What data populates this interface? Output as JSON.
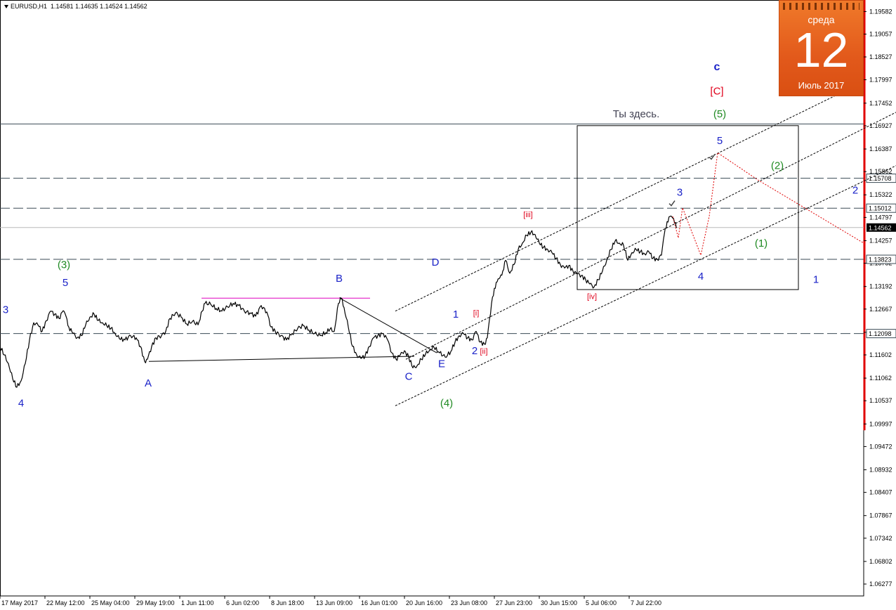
{
  "header": {
    "symbol": "EURUSD,H1",
    "ohlc": "1.14581 1.14635 1.14524 1.14562"
  },
  "calendar": {
    "weekday": "среда",
    "day": "12",
    "month_year": "Июль 2017"
  },
  "colors": {
    "wave_blue": "#1a22c8",
    "wave_green": "#1f8a22",
    "wave_red": "#e0001a",
    "price": "#000000",
    "magenta": "#e000c0",
    "calendar_orange": "#e65c17",
    "scale_bar": "#e00000",
    "forecast": "#e00000"
  },
  "chart_data": {
    "type": "line",
    "title": "",
    "xlabel": "",
    "ylabel": "",
    "ylim": [
      1.06,
      1.1985
    ],
    "y_ticks": [
      "1.19582",
      "1.19057",
      "1.18527",
      "1.17997",
      "1.17452",
      "1.16927",
      "1.16387",
      "1.15862",
      "1.15322",
      "1.14797",
      "1.14257",
      "1.13732",
      "1.13192",
      "1.12667",
      "1.12127",
      "1.11602",
      "1.11062",
      "1.10537",
      "1.09997",
      "1.09472",
      "1.08932",
      "1.08407",
      "1.07867",
      "1.07342",
      "1.06802",
      "1.06277"
    ],
    "x_ticks": [
      {
        "label": "17 May 2017",
        "t": 0
      },
      {
        "label": "22 May 12:00",
        "t": 64
      },
      {
        "label": "25 May 04:00",
        "t": 128
      },
      {
        "label": "29 May 19:00",
        "t": 192
      },
      {
        "label": "1 Jun 11:00",
        "t": 256
      },
      {
        "label": "6 Jun 02:00",
        "t": 320
      },
      {
        "label": "8 Jun 18:00",
        "t": 384
      },
      {
        "label": "13 Jun 09:00",
        "t": 448
      },
      {
        "label": "16 Jun 01:00",
        "t": 512
      },
      {
        "label": "20 Jun 16:00",
        "t": 576
      },
      {
        "label": "23 Jun 08:00",
        "t": 640
      },
      {
        "label": "27 Jun 23:00",
        "t": 704
      },
      {
        "label": "30 Jun 15:00",
        "t": 768
      },
      {
        "label": "5 Jul 06:00",
        "t": 832
      },
      {
        "label": "7 Jul 22:00",
        "t": 896
      }
    ],
    "current_price": "1.14562",
    "levels": [
      {
        "value": 1.15708,
        "label": "1.15708",
        "style": "dash"
      },
      {
        "value": 1.15012,
        "label": "1.15012",
        "style": "dash"
      },
      {
        "value": 1.13823,
        "label": "1.13823",
        "style": "dash"
      },
      {
        "value": 1.12098,
        "label": "1.12098",
        "style": "dash"
      },
      {
        "value": 1.14562,
        "label": "1.14562",
        "style": "current"
      },
      {
        "value": 1.1697,
        "label": "",
        "style": "solid"
      }
    ],
    "series": [
      {
        "name": "",
        "points": [
          [
            0,
            1.118
          ],
          [
            6,
            1.116
          ],
          [
            12,
            1.114
          ],
          [
            18,
            1.1105
          ],
          [
            24,
            1.1085
          ],
          [
            30,
            1.11
          ],
          [
            36,
            1.114
          ],
          [
            42,
            1.1195
          ],
          [
            48,
            1.1235
          ],
          [
            54,
            1.123
          ],
          [
            60,
            1.1215
          ],
          [
            66,
            1.124
          ],
          [
            72,
            1.1262
          ],
          [
            78,
            1.1255
          ],
          [
            84,
            1.1245
          ],
          [
            90,
            1.1263
          ],
          [
            94,
            1.125
          ],
          [
            98,
            1.1225
          ],
          [
            104,
            1.121
          ],
          [
            110,
            1.12
          ],
          [
            116,
            1.1205
          ],
          [
            122,
            1.123
          ],
          [
            128,
            1.1248
          ],
          [
            134,
            1.1255
          ],
          [
            140,
            1.124
          ],
          [
            146,
            1.1235
          ],
          [
            152,
            1.1228
          ],
          [
            158,
            1.1222
          ],
          [
            164,
            1.121
          ],
          [
            170,
            1.1198
          ],
          [
            178,
            1.1195
          ],
          [
            186,
            1.1205
          ],
          [
            194,
            1.12
          ],
          [
            200,
            1.118
          ],
          [
            206,
            1.1145
          ],
          [
            210,
            1.115
          ],
          [
            216,
            1.118
          ],
          [
            222,
            1.12
          ],
          [
            230,
            1.1205
          ],
          [
            236,
            1.1215
          ],
          [
            242,
            1.1245
          ],
          [
            250,
            1.1258
          ],
          [
            258,
            1.1248
          ],
          [
            266,
            1.1232
          ],
          [
            274,
            1.1238
          ],
          [
            282,
            1.123
          ],
          [
            288,
            1.1262
          ],
          [
            292,
            1.128
          ],
          [
            300,
            1.1278
          ],
          [
            308,
            1.1268
          ],
          [
            316,
            1.1262
          ],
          [
            324,
            1.1272
          ],
          [
            332,
            1.128
          ],
          [
            340,
            1.1275
          ],
          [
            348,
            1.1262
          ],
          [
            356,
            1.1258
          ],
          [
            364,
            1.125
          ],
          [
            372,
            1.1275
          ],
          [
            380,
            1.126
          ],
          [
            386,
            1.1225
          ],
          [
            392,
            1.1215
          ],
          [
            400,
            1.1205
          ],
          [
            408,
            1.1195
          ],
          [
            416,
            1.121
          ],
          [
            424,
            1.1222
          ],
          [
            432,
            1.1228
          ],
          [
            440,
            1.1218
          ],
          [
            448,
            1.121
          ],
          [
            456,
            1.1205
          ],
          [
            464,
            1.1212
          ],
          [
            470,
            1.122
          ],
          [
            476,
            1.1215
          ],
          [
            482,
            1.128
          ],
          [
            486,
            1.1292
          ],
          [
            490,
            1.127
          ],
          [
            496,
            1.1225
          ],
          [
            502,
            1.118
          ],
          [
            508,
            1.116
          ],
          [
            514,
            1.1152
          ],
          [
            520,
            1.1158
          ],
          [
            526,
            1.118
          ],
          [
            532,
            1.12
          ],
          [
            538,
            1.1205
          ],
          [
            546,
            1.121
          ],
          [
            552,
            1.1195
          ],
          [
            558,
            1.1165
          ],
          [
            564,
            1.115
          ],
          [
            570,
            1.116
          ],
          [
            576,
            1.117
          ],
          [
            582,
            1.1155
          ],
          [
            588,
            1.113
          ],
          [
            594,
            1.1135
          ],
          [
            600,
            1.115
          ],
          [
            606,
            1.1162
          ],
          [
            612,
            1.1172
          ],
          [
            618,
            1.1178
          ],
          [
            626,
            1.1165
          ],
          [
            634,
            1.1155
          ],
          [
            642,
            1.1168
          ],
          [
            648,
            1.119
          ],
          [
            654,
            1.1205
          ],
          [
            660,
            1.121
          ],
          [
            666,
            1.12
          ],
          [
            672,
            1.1195
          ],
          [
            678,
            1.1215
          ],
          [
            684,
            1.119
          ],
          [
            690,
            1.1185
          ],
          [
            694,
            1.12
          ],
          [
            700,
            1.128
          ],
          [
            704,
            1.1315
          ],
          [
            708,
            1.133
          ],
          [
            712,
            1.134
          ],
          [
            716,
            1.1355
          ],
          [
            720,
            1.138
          ],
          [
            726,
            1.135
          ],
          [
            732,
            1.137
          ],
          [
            738,
            1.1405
          ],
          [
            744,
            1.142
          ],
          [
            750,
            1.1438
          ],
          [
            756,
            1.1445
          ],
          [
            762,
            1.144
          ],
          [
            768,
            1.142
          ],
          [
            774,
            1.141
          ],
          [
            780,
            1.1405
          ],
          [
            786,
            1.1398
          ],
          [
            792,
            1.1385
          ],
          [
            798,
            1.137
          ],
          [
            804,
            1.1362
          ],
          [
            810,
            1.1368
          ],
          [
            816,
            1.1355
          ],
          [
            822,
            1.1348
          ],
          [
            828,
            1.1345
          ],
          [
            834,
            1.1335
          ],
          [
            840,
            1.1325
          ],
          [
            846,
            1.1318
          ],
          [
            852,
            1.1335
          ],
          [
            858,
            1.1355
          ],
          [
            864,
            1.138
          ],
          [
            870,
            1.1405
          ],
          [
            876,
            1.1425
          ],
          [
            882,
            1.142
          ],
          [
            888,
            1.1415
          ],
          [
            894,
            1.138
          ],
          [
            900,
            1.1398
          ],
          [
            906,
            1.1405
          ],
          [
            912,
            1.14
          ],
          [
            918,
            1.1395
          ],
          [
            924,
            1.14
          ],
          [
            930,
            1.1385
          ],
          [
            936,
            1.1382
          ],
          [
            942,
            1.1392
          ],
          [
            946,
            1.144
          ],
          [
            950,
            1.147
          ],
          [
            954,
            1.1482
          ],
          [
            958,
            1.1478
          ],
          [
            962,
            1.1468
          ],
          [
            964,
            1.1456
          ]
        ]
      }
    ],
    "wave_labels": [
      {
        "text": "3",
        "t": 8,
        "y": 1.1257,
        "color": "blue"
      },
      {
        "text": "4",
        "t": 30,
        "y": 1.104,
        "color": "blue"
      },
      {
        "text": "5",
        "t": 93,
        "y": 1.132,
        "color": "blue"
      },
      {
        "text": "(3)",
        "t": 91,
        "y": 1.1362,
        "color": "green"
      },
      {
        "text": "A",
        "t": 211,
        "y": 1.1087,
        "color": "blue"
      },
      {
        "text": "B",
        "t": 483,
        "y": 1.133,
        "color": "blue"
      },
      {
        "text": "C",
        "t": 582,
        "y": 1.1102,
        "color": "blue"
      },
      {
        "text": "E",
        "t": 629,
        "y": 1.1132,
        "color": "blue"
      },
      {
        "text": "D",
        "t": 620,
        "y": 1.1368,
        "color": "blue"
      },
      {
        "text": "(4)",
        "t": 636,
        "y": 1.104,
        "color": "green"
      },
      {
        "text": "1",
        "t": 649,
        "y": 1.1247,
        "color": "blue"
      },
      {
        "text": "2",
        "t": 676,
        "y": 1.1162,
        "color": "blue"
      },
      {
        "text": "[i]",
        "t": 678,
        "y": 1.1252,
        "color": "red"
      },
      {
        "text": "[ii]",
        "t": 689,
        "y": 1.1163,
        "color": "red"
      },
      {
        "text": "[iii]",
        "t": 752,
        "y": 1.148,
        "color": "red"
      },
      {
        "text": "[iv]",
        "t": 843,
        "y": 1.129,
        "color": "red"
      },
      {
        "text": "3",
        "t": 968,
        "y": 1.153,
        "color": "blue"
      },
      {
        "text": "4",
        "t": 998,
        "y": 1.1335,
        "color": "blue"
      },
      {
        "text": "5",
        "t": 1025,
        "y": 1.165,
        "color": "blue"
      },
      {
        "text": "(1)",
        "t": 1084,
        "y": 1.1412,
        "color": "green"
      },
      {
        "text": "(2)",
        "t": 1107,
        "y": 1.1592,
        "color": "green"
      },
      {
        "text": "(5)",
        "t": 1025,
        "y": 1.1712,
        "color": "green"
      },
      {
        "text": "[C]",
        "t": 1021,
        "y": 1.1765,
        "color": "red"
      },
      {
        "text": "c",
        "t": 1021,
        "y": 1.1822,
        "color": "blue_bold"
      },
      {
        "text": "1",
        "t": 1162,
        "y": 1.1328,
        "color": "blue"
      },
      {
        "text": "2",
        "t": 1218,
        "y": 1.1535,
        "color": "blue"
      }
    ],
    "annotation": {
      "text": "Ты здесь.",
      "t": 906,
      "y": 1.1712
    },
    "box": {
      "t1": 822,
      "t2": 1137,
      "y_top": 1.1693,
      "y_bottom": 1.1312
    },
    "triangle": {
      "upper": [
        [
          483,
          1.1293
        ],
        [
          622,
          1.1165
        ]
      ],
      "lower": [
        [
          212,
          1.1145
        ],
        [
          590,
          1.1157
        ]
      ],
      "magenta": [
        [
          287,
          1.1292
        ],
        [
          527,
          1.1292
        ]
      ]
    },
    "channel": [
      [
        [
          563,
          1.1262
        ],
        [
          1230,
          1.1795
        ]
      ],
      [
        [
          578,
          1.115
        ],
        [
          1276,
          1.1724
        ]
      ],
      [
        [
          563,
          1.1042
        ],
        [
          1276,
          1.16
        ]
      ]
    ],
    "forecast_path": [
      [
        958,
        1.1482
      ],
      [
        966,
        1.1432
      ],
      [
        972,
        1.1502
      ],
      [
        998,
        1.1392
      ],
      [
        1010,
        1.1482
      ],
      [
        1022,
        1.163
      ],
      [
        1080,
        1.1566
      ],
      [
        1230,
        1.142
      ]
    ],
    "checkmarks": [
      {
        "t": 957,
        "y": 1.1512
      },
      {
        "t": 1014,
        "y": 1.162
      }
    ]
  }
}
